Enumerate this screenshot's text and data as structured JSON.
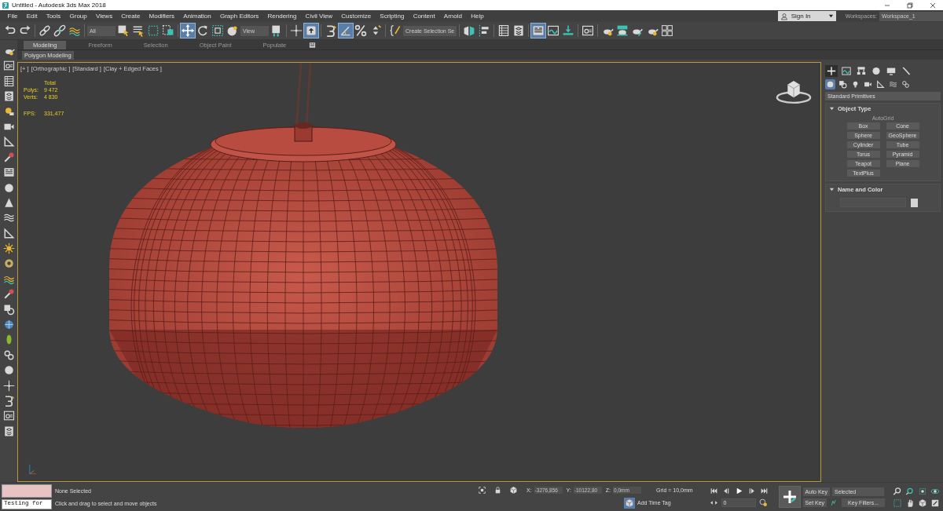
{
  "window": {
    "title": "Untitled - Autodesk 3ds Max 2018"
  },
  "menu": [
    "File",
    "Edit",
    "Tools",
    "Group",
    "Views",
    "Create",
    "Modifiers",
    "Animation",
    "Graph Editors",
    "Rendering",
    "Civil View",
    "Customize",
    "Scripting",
    "Content",
    "Arnold",
    "Help"
  ],
  "account": {
    "sign_in": "Sign In",
    "workspaces_label": "Workspaces:",
    "workspace": "Workspace_1"
  },
  "toolbar": [
    {
      "kind": "button",
      "selected": false
    },
    {
      "kind": "button",
      "selected": false
    },
    {
      "kind": "separator"
    },
    {
      "kind": "button",
      "selected": false
    },
    {
      "kind": "button",
      "selected": false
    },
    {
      "kind": "button",
      "selected": false
    },
    {
      "kind": "separator"
    },
    {
      "kind": "dropdown",
      "value": "All"
    },
    {
      "kind": "button",
      "selected": false
    },
    {
      "kind": "button",
      "selected": false
    },
    {
      "kind": "button",
      "selected": false
    },
    {
      "kind": "button",
      "selected": false
    },
    {
      "kind": "separator"
    },
    {
      "kind": "button",
      "selected": true
    },
    {
      "kind": "button",
      "selected": false
    },
    {
      "kind": "button",
      "selected": false
    },
    {
      "kind": "button",
      "selected": false
    },
    {
      "kind": "dropdown",
      "value": "View"
    },
    {
      "kind": "button",
      "selected": false
    },
    {
      "kind": "separator"
    },
    {
      "kind": "button",
      "selected": false
    },
    {
      "kind": "button",
      "selected": true
    },
    {
      "kind": "separator"
    },
    {
      "kind": "button",
      "selected": false
    },
    {
      "kind": "button",
      "selected": true
    },
    {
      "kind": "button",
      "selected": false
    },
    {
      "kind": "button",
      "selected": false
    },
    {
      "kind": "separator"
    },
    {
      "kind": "button",
      "selected": false
    },
    {
      "kind": "dropdown",
      "value": "Create Selection Se"
    },
    {
      "kind": "separator"
    },
    {
      "kind": "button",
      "selected": false
    },
    {
      "kind": "button",
      "selected": false
    },
    {
      "kind": "separator"
    },
    {
      "kind": "button",
      "selected": false
    },
    {
      "kind": "button",
      "selected": false
    },
    {
      "kind": "separator"
    },
    {
      "kind": "button",
      "selected": true
    },
    {
      "kind": "button",
      "selected": false
    },
    {
      "kind": "button",
      "selected": false
    },
    {
      "kind": "separator"
    },
    {
      "kind": "button",
      "selected": false
    },
    {
      "kind": "separator"
    },
    {
      "kind": "button",
      "selected": false
    },
    {
      "kind": "button",
      "selected": false
    },
    {
      "kind": "button",
      "selected": false
    },
    {
      "kind": "button",
      "selected": false
    },
    {
      "kind": "button",
      "selected": false
    }
  ],
  "ribbon": {
    "tabs": [
      {
        "label": "Modeling",
        "selected": true
      },
      {
        "label": "Freeform",
        "selected": false
      },
      {
        "label": "Selection",
        "selected": false
      },
      {
        "label": "Object Paint",
        "selected": false
      },
      {
        "label": "Populate",
        "selected": false
      }
    ],
    "panel": "Polygon Modeling"
  },
  "viewport": {
    "labels": [
      "[+ ]",
      "[Orthographic ]",
      "[Standard ]",
      "[Clay + Edged Faces ]"
    ],
    "stats": {
      "header": "Total",
      "rows": [
        {
          "label": "Polys:",
          "value": "9 472"
        },
        {
          "label": "Verts:",
          "value": "4 830"
        }
      ],
      "fps_label": "FPS:",
      "fps": "331,477"
    }
  },
  "command_panel": {
    "tabs": [
      {
        "selected": true
      },
      {
        "selected": false
      },
      {
        "selected": false
      },
      {
        "selected": false
      },
      {
        "selected": false
      },
      {
        "selected": false
      }
    ],
    "categories": [
      {
        "selected": true
      },
      {
        "selected": false
      },
      {
        "selected": false
      },
      {
        "selected": false
      },
      {
        "selected": false
      },
      {
        "selected": false
      },
      {
        "selected": false
      }
    ],
    "type": "Standard Primitives",
    "rollouts": [
      {
        "title": "Object Type",
        "expanded": true,
        "autogrid": "AutoGrid",
        "buttons": [
          "Box",
          "Cone",
          "Sphere",
          "GeoSphere",
          "Cylinder",
          "Tube",
          "Torus",
          "Pyramid",
          "Teapot",
          "Plane",
          "TextPlus"
        ]
      },
      {
        "title": "Name and Color",
        "expanded": true
      }
    ]
  },
  "status": {
    "listener": "Testing for",
    "selection": "None Selected",
    "prompt": "Click and drag to select and move objects",
    "coords": [
      {
        "axis": "X:",
        "value": "-3276,856"
      },
      {
        "axis": "Y:",
        "value": "-10122,80"
      },
      {
        "axis": "Z:",
        "value": "0,0mm"
      }
    ],
    "grid": "Grid = 10,0mm",
    "time_tag": "Add Time Tag",
    "frame": "0",
    "auto_key": "Auto Key",
    "key_set": "Selected",
    "set_key": "Set Key",
    "key_filters": "Key Filters..."
  }
}
